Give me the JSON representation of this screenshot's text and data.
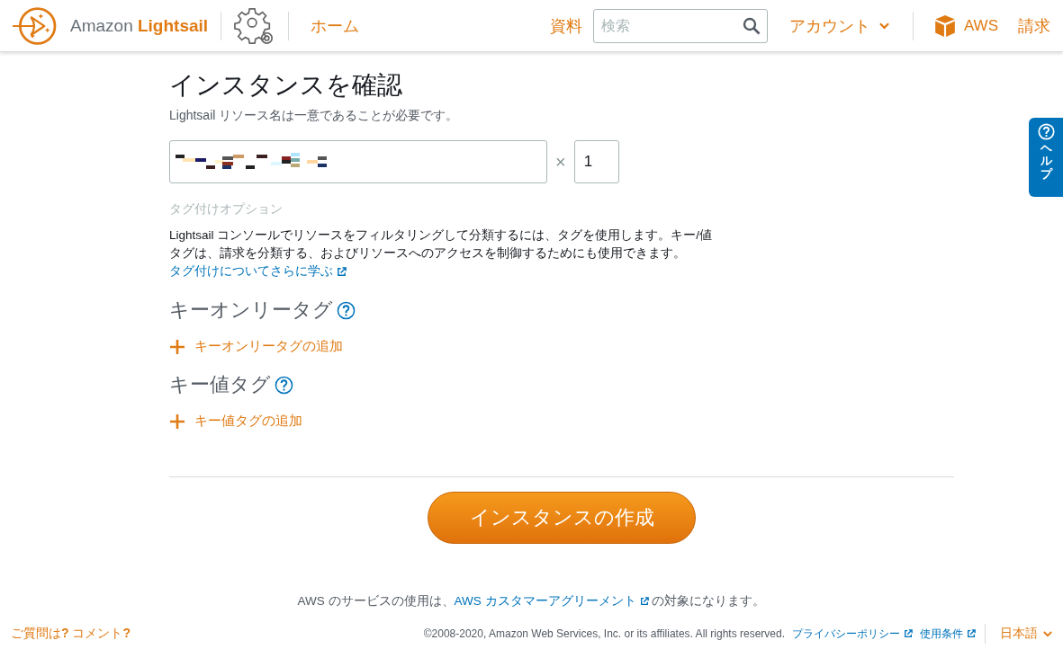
{
  "header": {
    "brand_first": "Amazon",
    "brand_second": "Lightsail",
    "home": "ホーム",
    "docs": "資料",
    "search": {
      "placeholder": "検索"
    },
    "account": "アカウント",
    "aws": "AWS",
    "billing": "請求"
  },
  "page": {
    "title": "インスタンスを確認",
    "subtitle": "Lightsail リソース名は一意であることが必要です。",
    "multiply": "×",
    "count": "1",
    "tagging_heading": "タグ付けオプション",
    "tagging_description": "Lightsail コンソールでリソースをフィルタリングして分類するには、タグを使用します。キー/値タグは、請求を分類する、およびリソースへのアクセスを制御するためにも使用できます。",
    "learn_more": "タグ付けについてさらに学ぶ",
    "tag_sections": [
      {
        "title": "キーオンリータグ",
        "add": "キーオンリータグの追加"
      },
      {
        "title": "キー値タグ",
        "add": "キー値タグの追加"
      }
    ],
    "create_button": "インスタンスの作成"
  },
  "help_tab": "ヘルプ",
  "footer": {
    "feedback": "ご質問は**?** コメント**?**",
    "agreement_before": "AWS のサービスの使用は、",
    "agreement_link": "AWS カスタマーアグリーメント",
    "agreement_after": "の対象になります。",
    "copyright": "©2008-2020, Amazon Web Services, Inc. or its affiliates. All rights reserved.",
    "privacy": "プライバシーポリシー",
    "terms": "使用条件",
    "language": "日本語"
  }
}
